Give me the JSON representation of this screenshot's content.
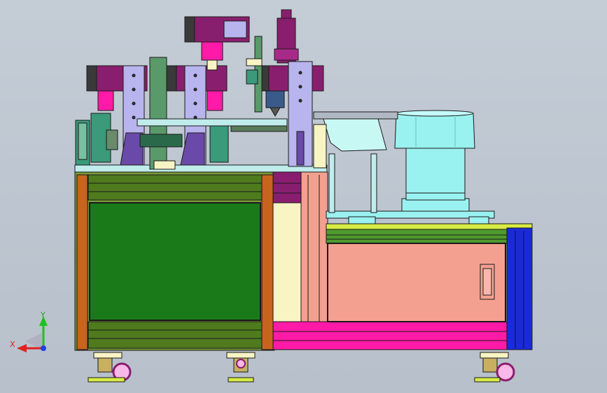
{
  "triad": {
    "x_label": "X",
    "y_label": "Y"
  },
  "colors": {
    "background": "#c0c8d2",
    "frame_orange": "#c8641e",
    "panel_green": "#1a7a1a",
    "rail_olive": "#4f7a1e",
    "magenta": "#ff1aa8",
    "purple_block": "#8a1e6e",
    "lavender": "#b8b4ee",
    "salmon": "#f4a090",
    "cream": "#f8f4c4",
    "blue_post": "#1a2ad8",
    "cyan_feeder": "#9af2f0",
    "yellow_rail": "#d8ec44",
    "axis_red": "#e02020",
    "axis_green": "#20c020",
    "axis_blue": "#2040e0"
  },
  "icons": [
    "axis-triad-icon",
    "caster-wheel-icon"
  ]
}
